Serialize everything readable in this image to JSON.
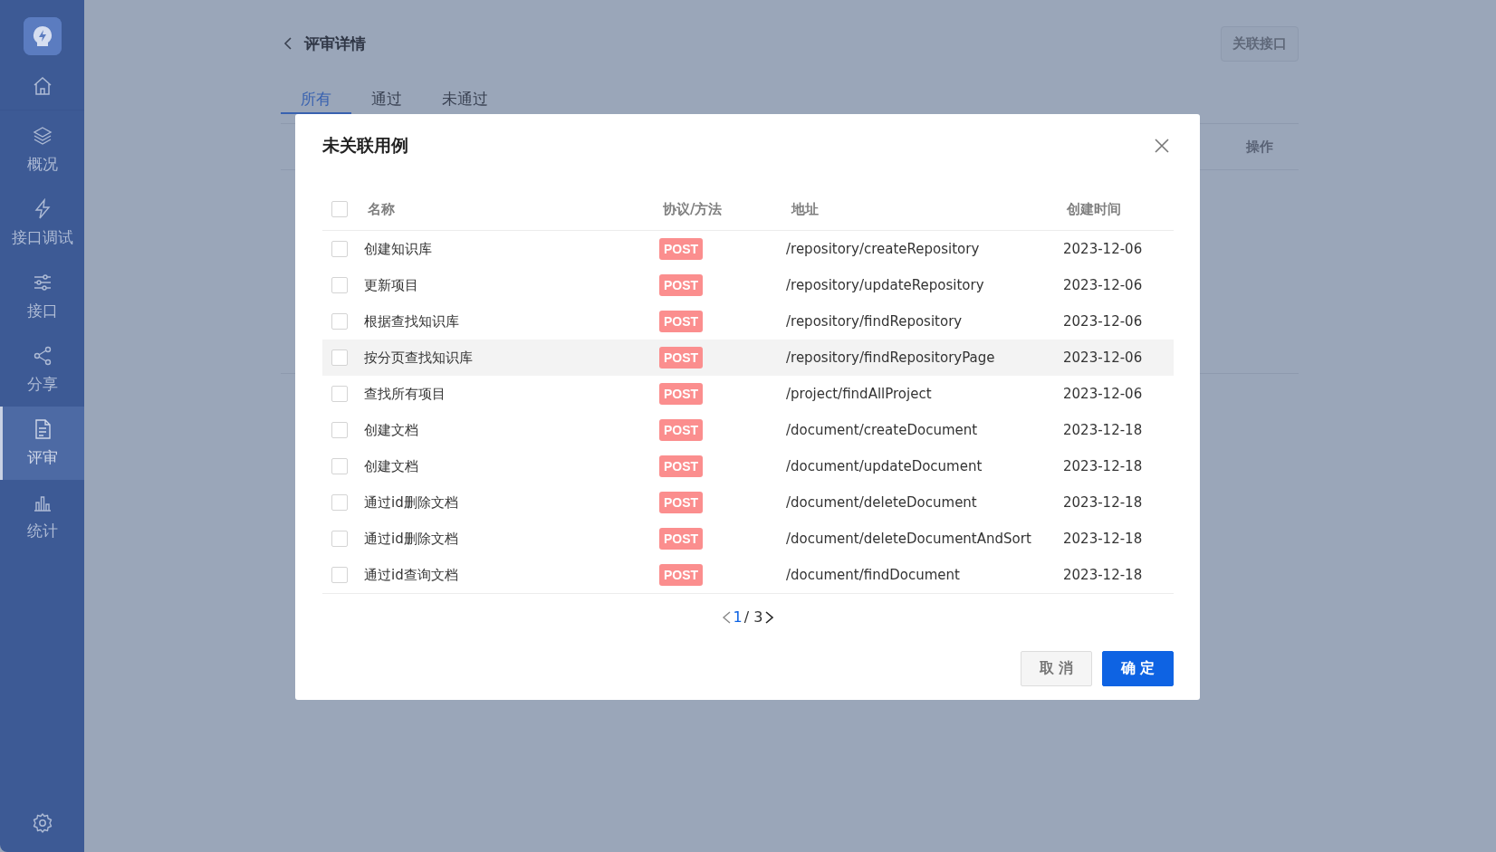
{
  "sidebar": {
    "items": [
      {
        "kind": "home",
        "selected": false
      },
      {
        "kind": "layers",
        "label": "概况",
        "selected": false
      },
      {
        "kind": "bolt",
        "label": "接口调试",
        "selected": false
      },
      {
        "kind": "sliders",
        "label": "接口",
        "selected": false
      },
      {
        "kind": "share",
        "label": "分享",
        "selected": false
      },
      {
        "kind": "doc",
        "label": "评审",
        "selected": true
      },
      {
        "kind": "chart",
        "label": "统计",
        "selected": false
      }
    ]
  },
  "page": {
    "title": "评审详情",
    "action": "关联接口",
    "tabs": [
      {
        "label": "所有",
        "selected": true
      },
      {
        "label": "通过",
        "selected": false
      },
      {
        "label": "未通过",
        "selected": false
      }
    ],
    "table": {
      "columns": [
        {
          "label": "操作"
        }
      ]
    }
  },
  "dialog": {
    "title": "未关联用例",
    "all_checked": false,
    "columns": [
      "名称",
      "协议/方法",
      "地址",
      "创建时间"
    ],
    "rows": [
      {
        "name": "创建知识库",
        "method": "POST",
        "address": "/repository/createRepository",
        "created": "2023-12-06",
        "checked": false,
        "hovered": false
      },
      {
        "name": "更新项目",
        "method": "POST",
        "address": "/repository/updateRepository",
        "created": "2023-12-06",
        "checked": false,
        "hovered": false
      },
      {
        "name": "根据查找知识库",
        "method": "POST",
        "address": "/repository/findRepository",
        "created": "2023-12-06",
        "checked": false,
        "hovered": false
      },
      {
        "name": "按分页查找知识库",
        "method": "POST",
        "address": "/repository/findRepositoryPage",
        "created": "2023-12-06",
        "checked": false,
        "hovered": true
      },
      {
        "name": "查找所有项目",
        "method": "POST",
        "address": "/project/findAllProject",
        "created": "2023-12-06",
        "checked": false,
        "hovered": false
      },
      {
        "name": "创建文档",
        "method": "POST",
        "address": "/document/createDocument",
        "created": "2023-12-18",
        "checked": false,
        "hovered": false
      },
      {
        "name": "创建文档",
        "method": "POST",
        "address": "/document/updateDocument",
        "created": "2023-12-18",
        "checked": false,
        "hovered": false
      },
      {
        "name": "通过id删除文档",
        "method": "POST",
        "address": "/document/deleteDocument",
        "created": "2023-12-18",
        "checked": false,
        "hovered": false
      },
      {
        "name": "通过id删除文档",
        "method": "POST",
        "address": "/document/deleteDocumentAndSort",
        "created": "2023-12-18",
        "checked": false,
        "hovered": false
      },
      {
        "name": "通过id查询文档",
        "method": "POST",
        "address": "/document/findDocument",
        "created": "2023-12-18",
        "checked": false,
        "hovered": false
      }
    ],
    "pagination": {
      "current": "1",
      "total": "/ 3"
    },
    "buttons": {
      "cancel": "取 消",
      "ok": "确 定"
    }
  }
}
